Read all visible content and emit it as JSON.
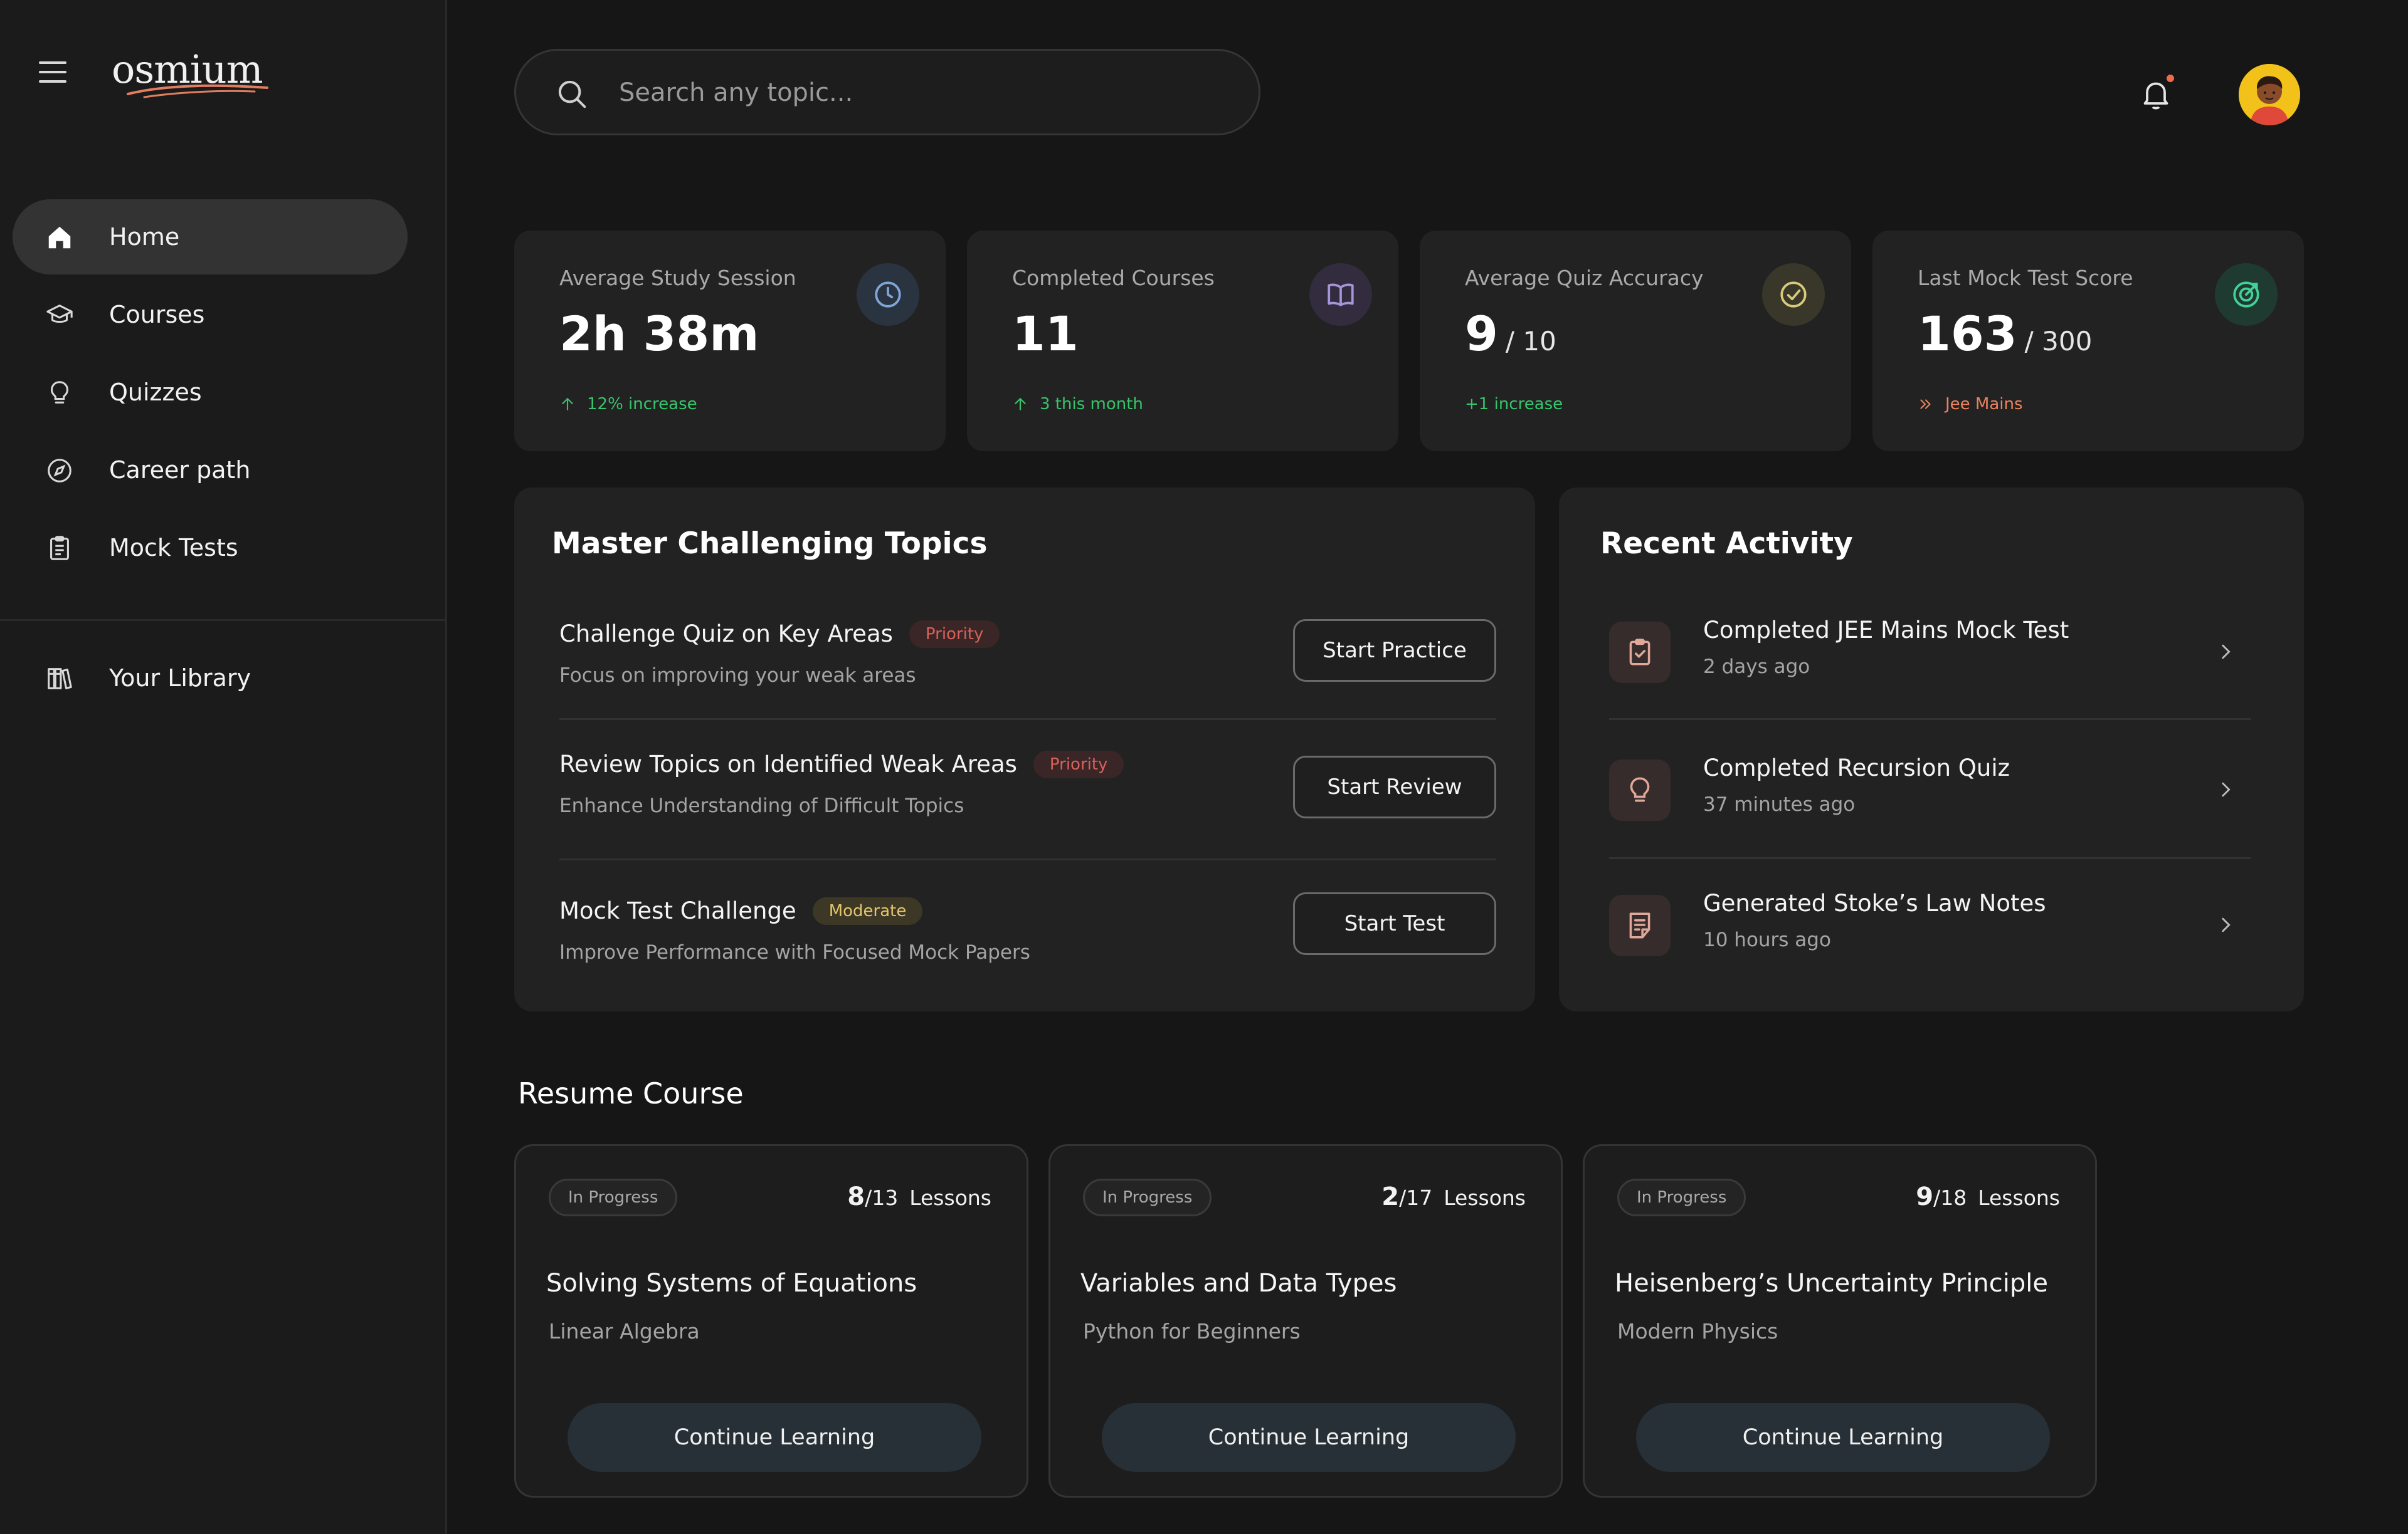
{
  "brand": {
    "logo_text": "osmium",
    "accent_color": "#e27e60"
  },
  "sidebar": {
    "items": [
      {
        "label": "Home",
        "icon": "home-icon",
        "active": true
      },
      {
        "label": "Courses",
        "icon": "graduation-cap-icon",
        "active": false
      },
      {
        "label": "Quizzes",
        "icon": "lightbulb-icon",
        "active": false
      },
      {
        "label": "Career path",
        "icon": "compass-icon",
        "active": false
      },
      {
        "label": "Mock Tests",
        "icon": "clipboard-icon",
        "active": false
      }
    ],
    "library": {
      "label": "Your Library",
      "icon": "library-icon"
    }
  },
  "header": {
    "search_placeholder": "Search any topic...",
    "has_notification": true,
    "notification_dot_color": "#f06a4a"
  },
  "stats": [
    {
      "title": "Average Study Session",
      "value": "2h 38m",
      "sub": "",
      "trend": "12% increase",
      "trend_color": "#36c46a",
      "icon": "clock-icon"
    },
    {
      "title": "Completed Courses",
      "value": "11",
      "sub": "",
      "trend": "3 this month",
      "trend_color": "#36c46a",
      "icon": "book-open-icon"
    },
    {
      "title": "Average Quiz Accuracy",
      "value": "9",
      "sub": "/ 10",
      "trend": "+1 increase",
      "trend_color": "#36c46a",
      "icon": "check-circle-icon"
    },
    {
      "title": "Last Mock Test Score",
      "value": "163",
      "sub": "/ 300",
      "trend": "Jee Mains",
      "trend_color": "#e9825f",
      "icon": "target-icon"
    }
  ],
  "challenges": {
    "title": "Master Challenging Topics",
    "items": [
      {
        "title": "Challenge Quiz on Key Areas",
        "tag": "Priority",
        "desc": "Focus on improving your weak areas",
        "button": "Start Practice"
      },
      {
        "title": "Review Topics on Identified Weak Areas",
        "tag": "Priority",
        "desc": "Enhance Understanding of Difficult Topics",
        "button": "Start Review"
      },
      {
        "title": "Mock Test Challenge",
        "tag": "Moderate",
        "desc": "Improve Performance with Focused Mock Papers",
        "button": "Start Test"
      }
    ]
  },
  "activity": {
    "title": "Recent Activity",
    "items": [
      {
        "title": "Completed JEE Mains Mock Test",
        "time": "2 days ago",
        "icon": "clipboard-check-icon"
      },
      {
        "title": "Completed Recursion Quiz",
        "time": "37 minutes ago",
        "icon": "lightbulb-icon"
      },
      {
        "title": "Generated Stoke’s Law Notes",
        "time": "10 hours ago",
        "icon": "notes-icon"
      }
    ]
  },
  "resume": {
    "title": "Resume Course",
    "courses": [
      {
        "status": "In Progress",
        "done": "8",
        "total": "/13",
        "lessons_word": "Lessons",
        "title": "Solving Systems of Equations",
        "subject": "Linear Algebra",
        "button": "Continue Learning"
      },
      {
        "status": "In Progress",
        "done": "2",
        "total": "/17",
        "lessons_word": "Lessons",
        "title": "Variables and Data Types",
        "subject": "Python for Beginners",
        "button": "Continue Learning"
      },
      {
        "status": "In Progress",
        "done": "9",
        "total": "/18",
        "lessons_word": "Lessons",
        "title": "Heisenberg’s Uncertainty Principle",
        "subject": "Modern  Physics",
        "button": "Continue Learning"
      }
    ]
  }
}
